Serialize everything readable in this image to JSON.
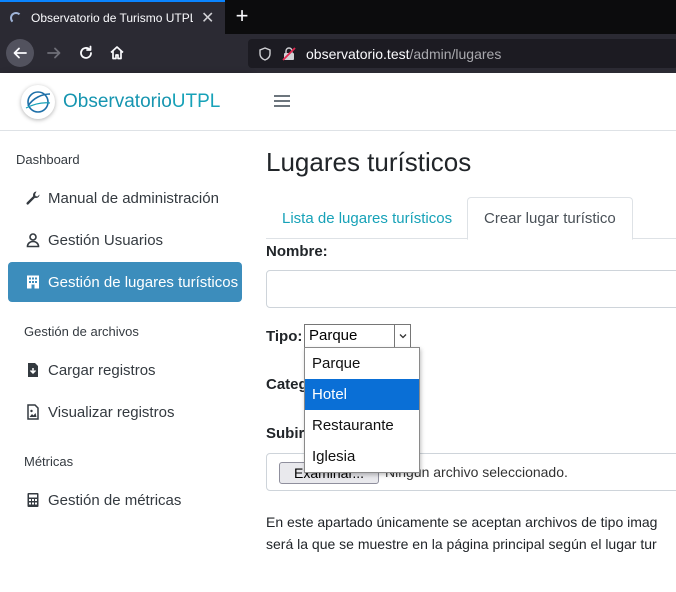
{
  "browser": {
    "tab_title": "Observatorio de Turismo UTPL",
    "new_tab_label": "+",
    "url_host": "observatorio.test",
    "url_path": "/admin/lugares"
  },
  "brand": {
    "part1": "Observatorio",
    "part2": "UTPL"
  },
  "sidebar": {
    "sections": [
      {
        "header": "Dashboard"
      },
      {
        "header": "Gestión de archivos"
      },
      {
        "header": "Métricas"
      }
    ],
    "items": [
      {
        "label": "Manual de administración",
        "icon": "wrench-icon"
      },
      {
        "label": "Gestión Usuarios",
        "icon": "user-icon"
      },
      {
        "label": "Gestión de lugares turísticos",
        "icon": "building-icon",
        "active": true
      },
      {
        "label": "Cargar registros",
        "icon": "file-download-icon"
      },
      {
        "label": "Visualizar registros",
        "icon": "file-image-icon"
      },
      {
        "label": "Gestión de métricas",
        "icon": "calculator-icon"
      }
    ]
  },
  "main": {
    "title": "Lugares turísticos",
    "tabs": [
      {
        "label": "Lista de lugares turísticos"
      },
      {
        "label": "Crear lugar turístico",
        "active": true
      }
    ],
    "form": {
      "nombre_label": "Nombre:",
      "nombre_value": "",
      "tipo_label": "Tipo:",
      "tipo_value": "Parque",
      "tipo_options": [
        "Parque",
        "Hotel",
        "Restaurante",
        "Iglesia"
      ],
      "tipo_highlighted": "Hotel",
      "categoria_label_visible": "Categ",
      "subir_label_visible": "Subir",
      "file_button": "Examinar...",
      "file_status": "Ningún archivo seleccionado.",
      "help_line1": "En este apartado únicamente se aceptan archivos de tipo imag",
      "help_line2": "será la que se muestre en la página principal según el lugar tur"
    }
  },
  "colors": {
    "accent": "#17a2b8",
    "active_nav": "#3c8dbc",
    "highlight": "#0a6fd6"
  }
}
